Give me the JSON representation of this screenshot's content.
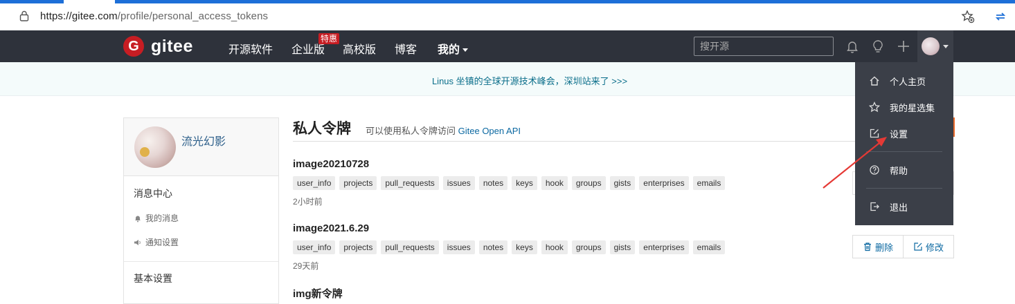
{
  "browser": {
    "url_host": "https://gitee.com",
    "url_path": "/profile/personal_access_tokens"
  },
  "header": {
    "logo_letter": "G",
    "logo_text": "gitee",
    "nav": [
      "开源软件",
      "企业版",
      "高校版",
      "博客",
      "我的"
    ],
    "enterprise_badge": "特惠",
    "search_placeholder": "搜开源"
  },
  "banner": {
    "text": "Linus 坐镇的全球开源技术峰会，深圳站来了 >>>"
  },
  "sidebar": {
    "username": "流光幻影",
    "section_messages": "消息中心",
    "my_messages": "我的消息",
    "notify_settings": "通知设置",
    "section_basic": "基本设置"
  },
  "main": {
    "title": "私人令牌",
    "subtitle_prefix": "可以使用私人令牌访问",
    "subtitle_link": "Gitee Open API",
    "tokens": [
      {
        "name": "image20210728",
        "scopes": [
          "user_info",
          "projects",
          "pull_requests",
          "issues",
          "notes",
          "keys",
          "hook",
          "groups",
          "gists",
          "enterprises",
          "emails"
        ],
        "time": "2小时前"
      },
      {
        "name": "image2021.6.29",
        "scopes": [
          "user_info",
          "projects",
          "pull_requests",
          "issues",
          "notes",
          "keys",
          "hook",
          "groups",
          "gists",
          "enterprises",
          "emails"
        ],
        "time": "29天前"
      },
      {
        "name": "img新令牌"
      }
    ],
    "delete_label": "删除",
    "edit_label": "修改"
  },
  "dropdown": {
    "items": [
      "个人主页",
      "我的星选集",
      "设置",
      "帮助",
      "退出"
    ]
  },
  "colors": {
    "header_bg": "#2e323b",
    "brand_red": "#c71d23",
    "link_blue": "#0b68a1",
    "annotation_red": "#e53935"
  }
}
